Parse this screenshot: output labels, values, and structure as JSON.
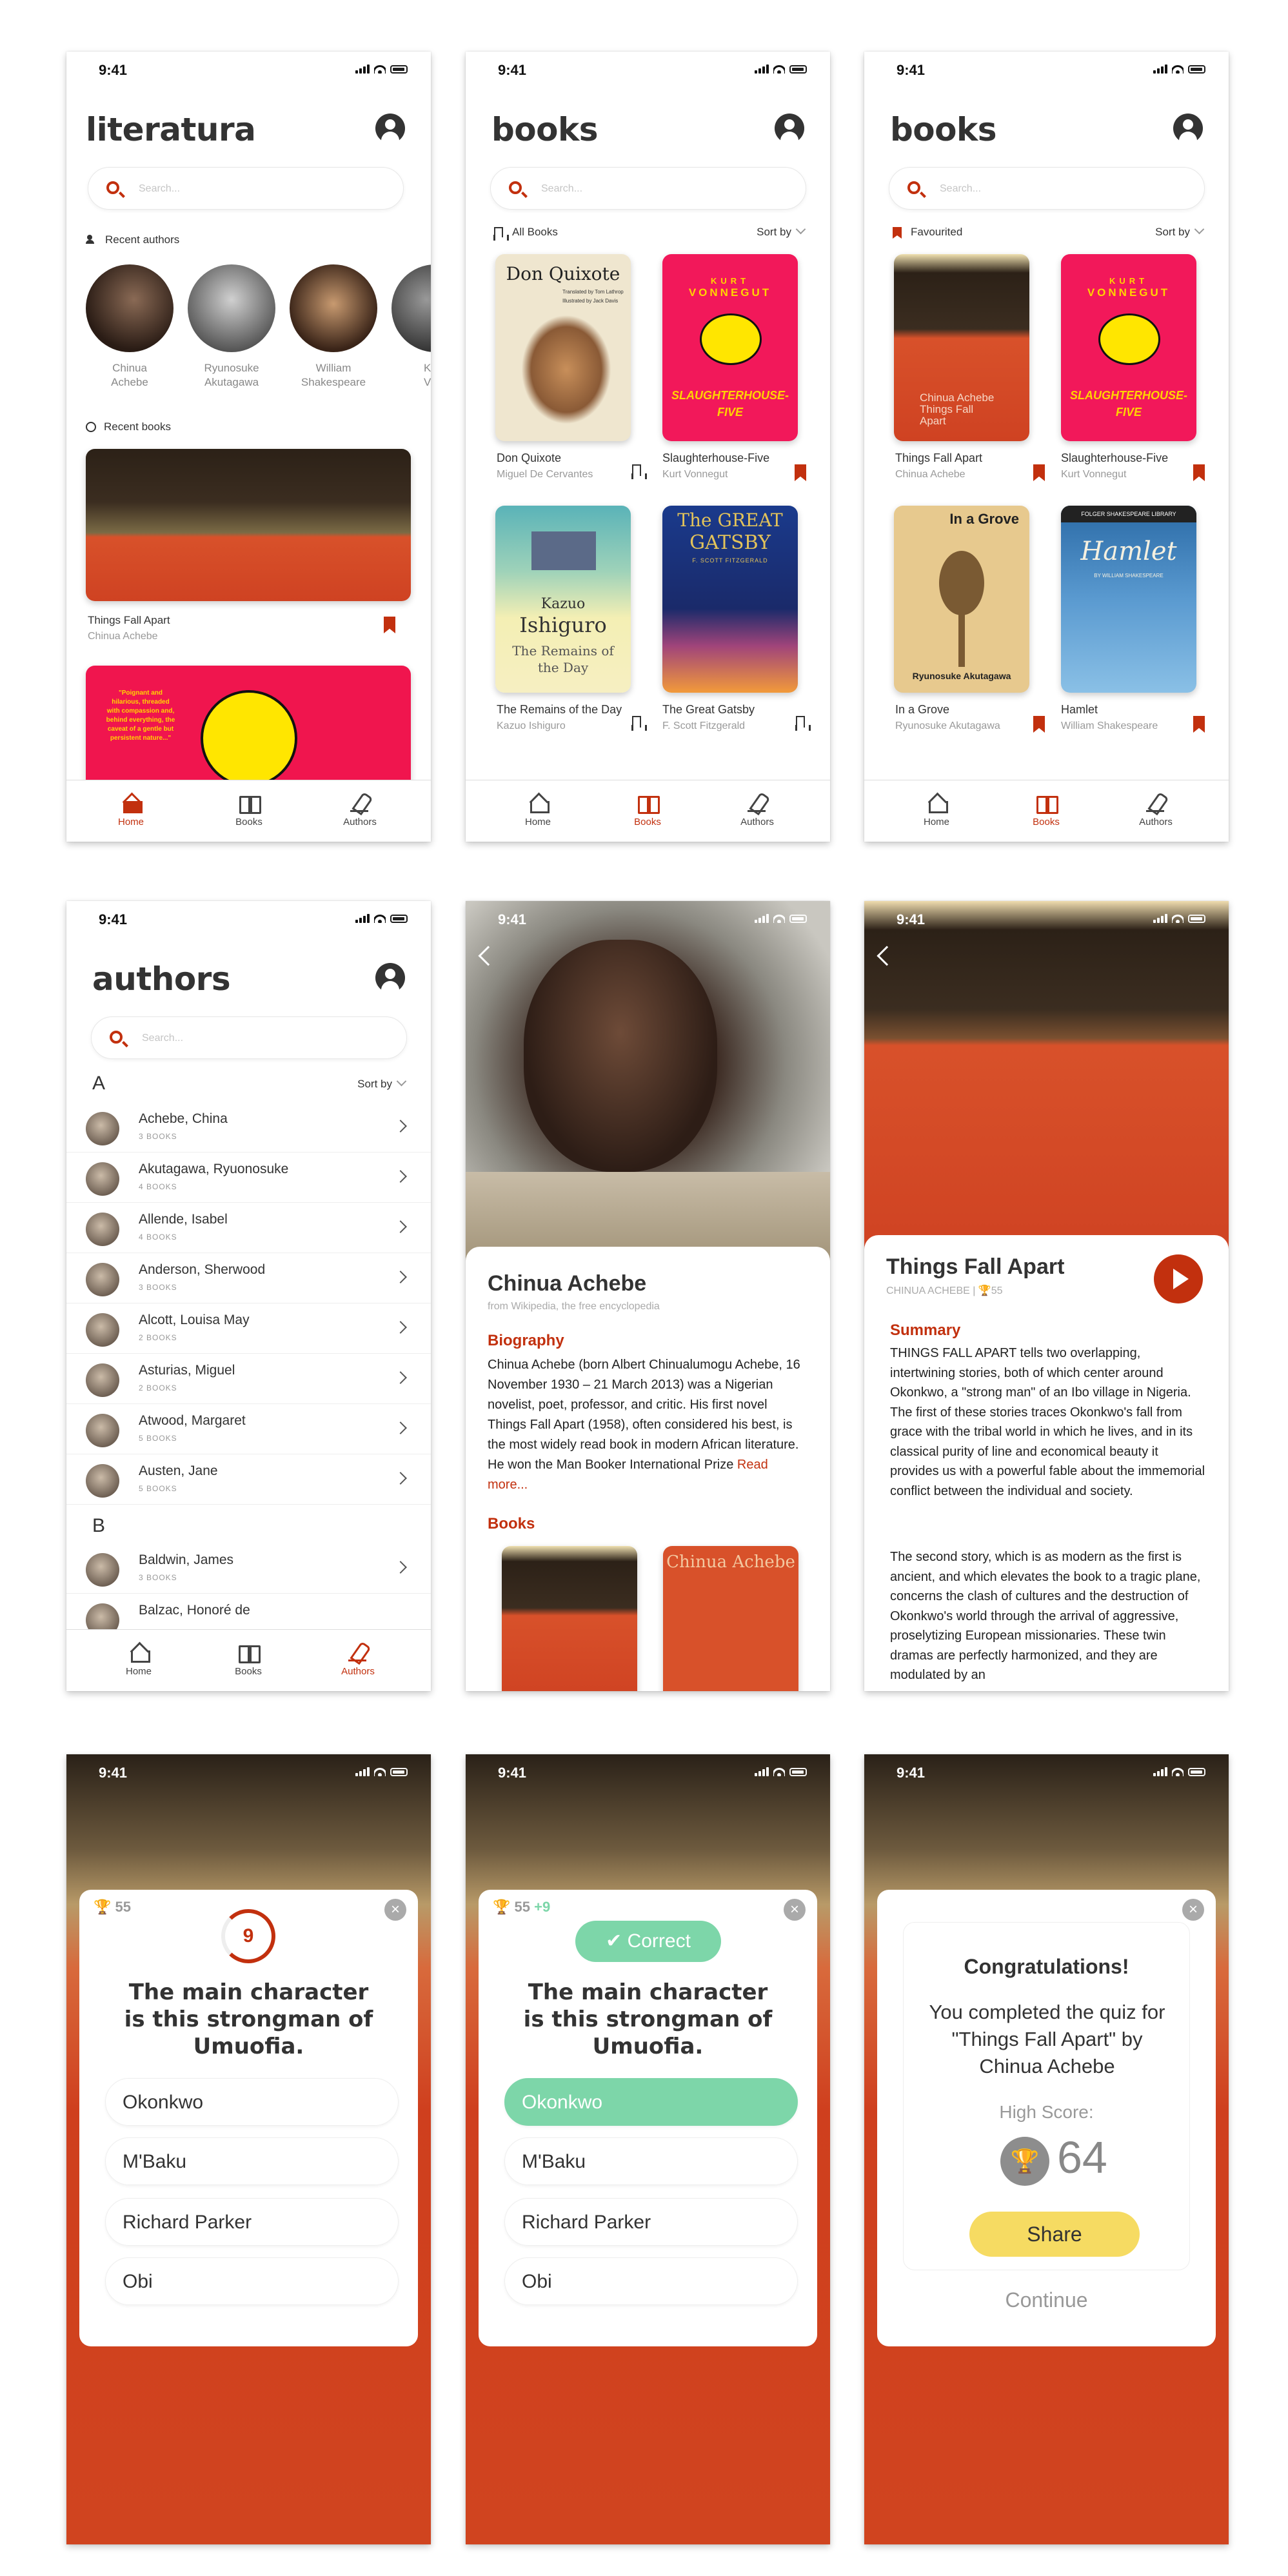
{
  "status": {
    "time": "9:41"
  },
  "search": {
    "placeholder": "Search..."
  },
  "tabs": {
    "home": "Home",
    "books": "Books",
    "authors": "Authors"
  },
  "home": {
    "title": "literatura",
    "recent_authors_label": "Recent authors",
    "authors": [
      {
        "line1": "Chinua",
        "line2": "Achebe"
      },
      {
        "line1": "Ryunosuke",
        "line2": "Akutagawa"
      },
      {
        "line1": "William",
        "line2": "Shakespeare"
      },
      {
        "line1": "K",
        "line2": "Von"
      }
    ],
    "recent_books_label": "Recent books",
    "book": {
      "title": "Things Fall Apart",
      "author": "Chinua Achebe"
    },
    "book2_cover_text": "\"Poignant and hilarious, threaded with compassion and, behind everything, the caveat of a gentle but persistent nature...\""
  },
  "books": {
    "title": "books",
    "filter": "All Books",
    "sort": "Sort by",
    "items": [
      {
        "title": "Don Quixote",
        "author": "Miguel De Cervantes",
        "cover_title": "Don Quixote",
        "cover_sub": "Translated by Tom Lathrop",
        "cover_sub2": "Illustrated by Jack Davis"
      },
      {
        "title": "Slaughterhouse-Five",
        "author": "Kurt Vonnegut",
        "cover_top": "KURT",
        "cover_mid": "VONNEGUT",
        "cover_bottom": "SLAUGHTERHOUSE-FIVE"
      },
      {
        "title": "The Remains of the Day",
        "author": "Kazuo Ishiguro",
        "cover_a": "Kazuo",
        "cover_b": "Ishiguro",
        "cover_c": "The Remains of the Day"
      },
      {
        "title": "The Great Gatsby",
        "author": "F. Scott Fitzgerald",
        "cover_a": "The GREAT",
        "cover_b": "GATSBY",
        "cover_c": "F. SCOTT FITZGERALD"
      }
    ]
  },
  "favs": {
    "title": "books",
    "filter": "Favourited",
    "sort": "Sort by",
    "items": [
      {
        "title": "Things Fall Apart",
        "author": "Chinua Achebe",
        "cover": "Chinua Achebe Things Fall Apart"
      },
      {
        "title": "Slaughterhouse-Five",
        "author": "Kurt Vonnegut"
      },
      {
        "title": "In a Grove",
        "author": "Ryunosuke Akutagawa",
        "cover_a": "In a Grove",
        "cover_b": "Ryunosuke Akutagawa"
      },
      {
        "title": "Hamlet",
        "author": "William Shakespeare",
        "cover_top": "FOLGER SHAKESPEARE LIBRARY",
        "cover_a": "Hamlet",
        "cover_b": "BY WILLIAM SHAKESPEARE"
      }
    ]
  },
  "authors": {
    "title": "authors",
    "sort": "Sort by",
    "letter_a": "A",
    "letter_b": "B",
    "list_a": [
      {
        "name": "Achebe, China",
        "books": "3 BOOKS"
      },
      {
        "name": "Akutagawa, Ryuonosuke",
        "books": "4 BOOKS"
      },
      {
        "name": "Allende, Isabel",
        "books": "4 BOOKS"
      },
      {
        "name": "Anderson, Sherwood",
        "books": "3 BOOKS"
      },
      {
        "name": "Alcott, Louisa May",
        "books": "2 BOOKS"
      },
      {
        "name": "Asturias, Miguel",
        "books": "2 BOOKS"
      },
      {
        "name": "Atwood, Margaret",
        "books": "5 BOOKS"
      },
      {
        "name": "Austen, Jane",
        "books": "5 BOOKS"
      }
    ],
    "list_b": [
      {
        "name": "Baldwin, James",
        "books": "3 BOOKS"
      },
      {
        "name": "Balzac, Honoré de",
        "books": ""
      }
    ]
  },
  "author_detail": {
    "name": "Chinua Achebe",
    "source": "from Wikipedia, the free encyclopedia",
    "bio_heading": "Biography",
    "bio": "Chinua Achebe (born Albert  Chinualumogu Achebe, 16 November 1930 – 21 March 2013) was a Nigerian novelist, poet, professor, and critic. His first novel Things Fall Apart (1958), often considered his best, is the most widely read book in modern African literature. He won the Man Booker International Prize",
    "read_more": "Read more...",
    "books_heading": "Books",
    "cover2": "Chinua Achebe"
  },
  "book_detail": {
    "title": "Things Fall Apart",
    "meta": "CHINUA ACHEBE | ",
    "score": "55",
    "summary_heading": "Summary",
    "p1": "THINGS FALL APART tells two overlapping, intertwining stories, both of which center around Okonkwo, a \"strong man\" of an Ibo village in Nigeria. The first of these stories traces Okonkwo's fall from grace with the tribal world in which he lives, and in its classical purity of line and economical beauty it provides us with a powerful fable about the immemorial conflict between the individual and society.",
    "p2": "The second story, which is as modern as the first is ancient, and which elevates the book to a tragic plane, concerns the clash of cultures and the destruction of Okonkwo's world through the arrival of aggressive, proselytizing European missionaries. These twin dramas are perfectly harmonized, and they are modulated by an"
  },
  "quiz": {
    "score": "55",
    "timer": "9",
    "bonus": "+9",
    "correct": "Correct",
    "question": "The main character is this strongman of Umuofia.",
    "options": [
      "Okonkwo",
      "M'Baku",
      "Richard Parker",
      "Obi"
    ],
    "close": "×"
  },
  "result": {
    "heading": "Congratulations!",
    "message": "You completed the quiz for \"Things Fall Apart\" by Chinua Achebe",
    "high_label": "High Score:",
    "high_score": "64",
    "share": "Share",
    "continue": "Continue"
  },
  "colors": {
    "accent": "#c2300e",
    "correct": "#7dd6a9",
    "share": "#f6db62"
  }
}
